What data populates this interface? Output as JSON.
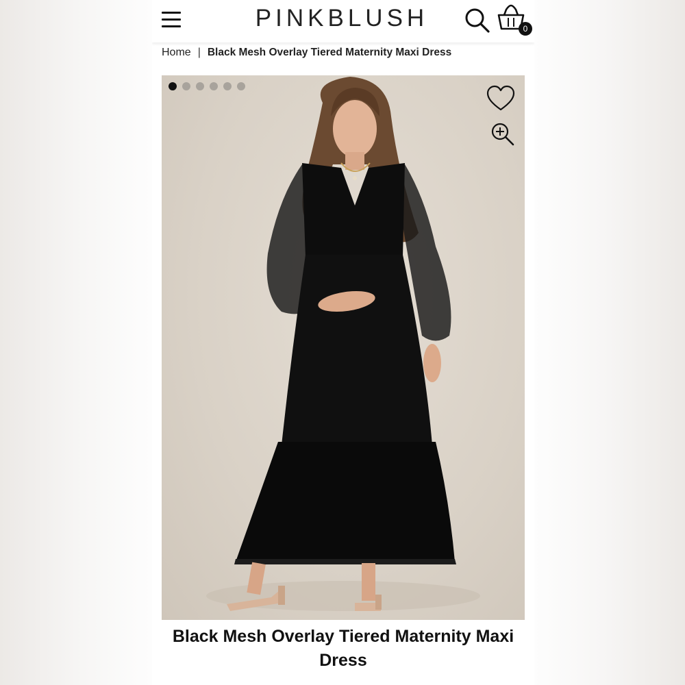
{
  "header": {
    "logo": "PINKBLUSH",
    "menu_icon": "hamburger-menu-icon",
    "search_icon": "search-icon",
    "cart_icon": "shopping-bag-icon",
    "cart_count": "0"
  },
  "breadcrumb": {
    "home": "Home",
    "separator": "|",
    "current": "Black Mesh Overlay Tiered Maternity Maxi Dress"
  },
  "gallery": {
    "image_count": 6,
    "active_index": 0,
    "favorite_icon": "heart-icon",
    "zoom_icon": "zoom-in-icon",
    "image_subject": "model wearing black mesh tiered maxi dress"
  },
  "product": {
    "title": "Black Mesh Overlay Tiered Maternity Maxi Dress"
  },
  "colors": {
    "text": "#111111",
    "background": "#ffffff",
    "photo_backdrop": "#d9d1c6",
    "dress": "#0d0d0d"
  }
}
